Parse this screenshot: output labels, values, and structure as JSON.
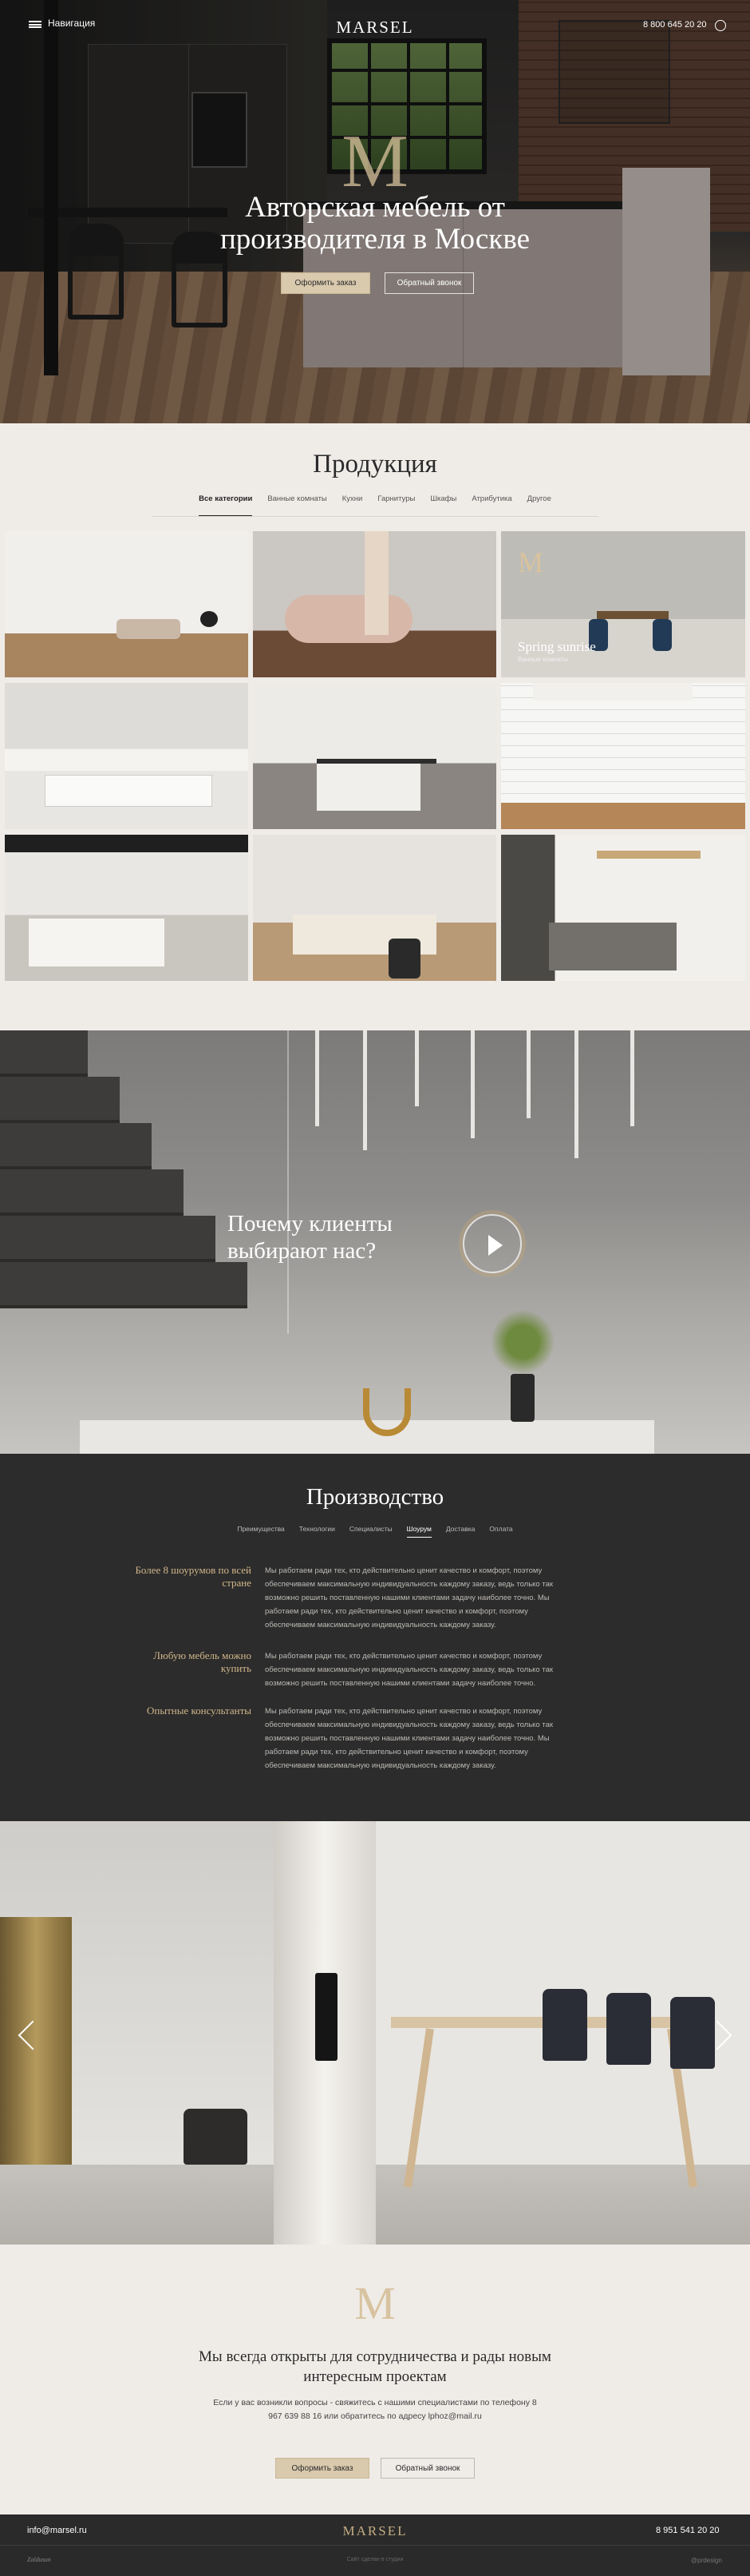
{
  "header": {
    "nav_label": "Навигация",
    "logo": "MARSEL",
    "phone": "8 800 645 20 20"
  },
  "hero": {
    "monogram": "M",
    "title": "Авторская мебель от производителя в Москве",
    "order_button": "Оформить заказ",
    "callback_button": "Обратный звонок"
  },
  "products": {
    "title": "Продукция",
    "filters": [
      "Все категории",
      "Ванные комнаты",
      "Кухни",
      "Гарнитуры",
      "Шкафы",
      "Атрибутика",
      "Другое"
    ],
    "active_filter": 0,
    "featured": {
      "monogram": "M",
      "name": "Spring sunrise",
      "category": "Ванные комнаты"
    }
  },
  "why": {
    "title": "Почему клиенты выбирают нас?"
  },
  "production": {
    "title": "Производство",
    "tabs": [
      "Преимущества",
      "Технологии",
      "Специалисты",
      "Шоурум",
      "Доставка",
      "Оплата"
    ],
    "active_tab": 3,
    "rows": [
      {
        "heading": "Более 8 шоурумов по всей стране",
        "text": "Мы работаем ради тех, кто действительно ценит качество и комфорт, поэтому обеспечиваем максимальную индивидуальность каждому заказу, ведь только так возможно решить поставленную нашими клиентами задачу наиболее точно. Мы работаем ради тех, кто действительно ценит качество и комфорт, поэтому обеспечиваем максимальную индивидуальность каждому заказу."
      },
      {
        "heading": "Любую мебель можно купить",
        "text": "Мы работаем ради тех, кто действительно ценит качество и комфорт, поэтому обеспечиваем максимальную индивидуальность каждому заказу, ведь только так возможно решить поставленную нашими клиентами задачу наиболее точно."
      },
      {
        "heading": "Опытные консультанты",
        "text": "Мы работаем ради тех, кто действительно ценит качество и комфорт, поэтому обеспечиваем максимальную индивидуальность каждому заказу, ведь только так возможно решить поставленную нашими клиентами задачу наиболее точно. Мы работаем ради тех, кто действительно ценит качество и комфорт, поэтому обеспечиваем максимальную индивидуальность каждому заказу."
      }
    ]
  },
  "contact": {
    "monogram": "M",
    "title": "Мы всегда открыты для сотрудничества и рады новым интересным проектам",
    "text": "Если у вас возникли вопросы - свяжитесь с нашими специалистами по телефону 8 967 639 88 16 или обратитесь по адресу lphoz@mail.ru",
    "order_button": "Оформить заказ",
    "callback_button": "Обратный звонок"
  },
  "footer": {
    "email": "info@marsel.ru",
    "logo": "MARSEL",
    "phone": "8 951 541 20 20",
    "left_small": "Zaldusun",
    "center_small": "Сайт сделан в студии",
    "right_small": "@prdesign"
  }
}
